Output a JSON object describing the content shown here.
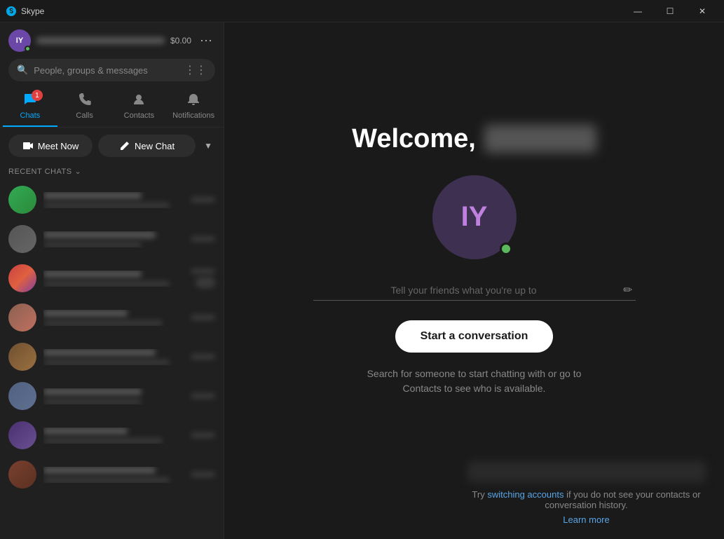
{
  "titleBar": {
    "appName": "Skype",
    "minimizeLabel": "Minimize",
    "restoreLabel": "Restore",
    "closeLabel": "Close"
  },
  "sidebar": {
    "profile": {
      "initials": "IY",
      "credit": "$0.00"
    },
    "search": {
      "placeholder": "People, groups & messages"
    },
    "navTabs": [
      {
        "id": "chats",
        "label": "Chats",
        "icon": "💬",
        "badge": "1",
        "active": true
      },
      {
        "id": "calls",
        "label": "Calls",
        "icon": "📞",
        "badge": "",
        "active": false
      },
      {
        "id": "contacts",
        "label": "Contacts",
        "icon": "👤",
        "badge": "",
        "active": false
      },
      {
        "id": "notifications",
        "label": "Notifications",
        "icon": "🔔",
        "badge": "",
        "active": false
      }
    ],
    "meetNowLabel": "Meet Now",
    "newChatLabel": "New Chat",
    "recentChatsLabel": "RECENT CHATS",
    "chatItems": [
      {
        "id": 1,
        "colorClass": "c1"
      },
      {
        "id": 2,
        "colorClass": "c2"
      },
      {
        "id": 3,
        "colorClass": "c3"
      },
      {
        "id": 4,
        "colorClass": "c4"
      },
      {
        "id": 5,
        "colorClass": "c5"
      },
      {
        "id": 6,
        "colorClass": "c6"
      },
      {
        "id": 7,
        "colorClass": "c7"
      },
      {
        "id": 8,
        "colorClass": "c8"
      }
    ]
  },
  "main": {
    "welcomeText": "Welcome,",
    "avatarInitials": "IY",
    "statusPlaceholder": "Tell your friends what you're up to",
    "startConversationLabel": "Start a conversation",
    "hintLine1": "Search for someone to start chatting with or go to",
    "hintLine2": "Contacts to see who is available.",
    "bottomText": "Try",
    "switchAccountsLabel": "switching accounts",
    "bottomTextMid": " if you do not see your contacts or conversation history.",
    "learnMoreLabel": "Learn more"
  }
}
